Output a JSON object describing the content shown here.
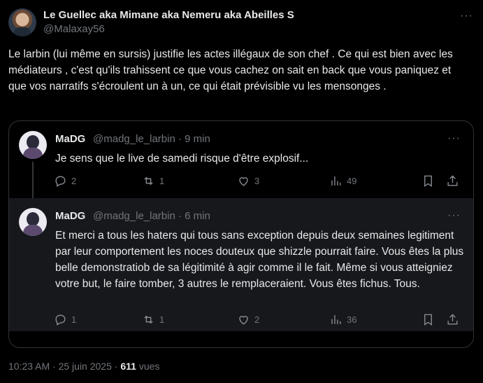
{
  "main": {
    "author_name": "Le Guellec aka Mimane aka Nemeru aka Abeilles S",
    "handle": "@Malaxay56",
    "more_icon": "more-horizontal-icon",
    "text": "Le larbin (lui même en sursis) justifie les actes illégaux de son chef . Ce qui est bien avec les médiateurs , c'est qu'ils trahissent ce que vous cachez on sait en back que vous paniquez et que vos narratifs s'écroulent un à un, ce qui était prévisible vu les mensonges ."
  },
  "quoted": [
    {
      "name": "MaDG",
      "meta": "@madg_le_larbin · 9 min",
      "text": "Je sens que le live de samedi risque d'être explosif...",
      "replies": "2",
      "retweets": "1",
      "likes": "3",
      "views": "49"
    },
    {
      "name": "MaDG",
      "meta": "@madg_le_larbin · 6 min",
      "text": "Et merci a tous les haters qui tous sans exception depuis deux semaines legitiment par leur comportement les noces douteux que shizzle pourrait faire. Vous êtes la plus belle demonstratiob de sa légitimité à agir comme il le fait. Même si vous atteigniez votre but, le faire tomber, 3 autres le remplaceraient. Vous êtes fichus. Tous.",
      "replies": "1",
      "retweets": "1",
      "likes": "2",
      "views": "36"
    }
  ],
  "footer": {
    "timestamp": "10:23 AM · 25 juin 2025 ·",
    "views_count": "611",
    "views_label": "vues"
  }
}
